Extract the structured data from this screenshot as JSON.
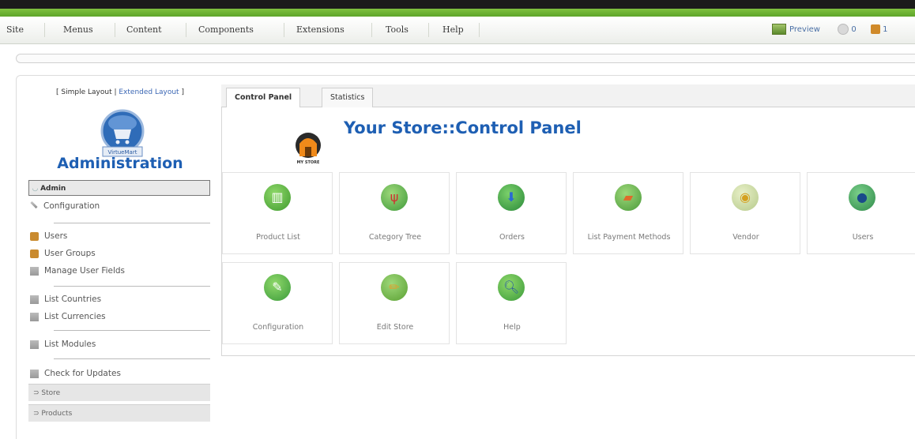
{
  "menubar": {
    "items": [
      "Site",
      "Menus",
      "Content",
      "Components",
      "Extensions",
      "Tools",
      "Help"
    ],
    "preview_label": "Preview",
    "messages_count": "0",
    "users_count": "1"
  },
  "sidebar": {
    "layout_open": "[ ",
    "simple_layout": "Simple Layout",
    "separator": " | ",
    "extended_layout": "Extended Layout",
    "layout_close": " ]",
    "logo_text": "VirtueMart",
    "title": "Administration",
    "section_header": "Admin",
    "items": [
      {
        "label": "Configuration",
        "icon": "wrench-icon"
      },
      {
        "label": "Users",
        "icon": "users-icon"
      },
      {
        "label": "User Groups",
        "icon": "user-groups-icon"
      },
      {
        "label": "Manage User Fields",
        "icon": "list-icon"
      },
      {
        "label": "List Countries",
        "icon": "list-icon"
      },
      {
        "label": "List Currencies",
        "icon": "list-icon"
      },
      {
        "label": "List Modules",
        "icon": "list-icon"
      },
      {
        "label": "Check for Updates",
        "icon": "list-icon"
      }
    ],
    "collapsed": [
      "Store",
      "Products"
    ]
  },
  "tabs": [
    {
      "label": "Control Panel",
      "active": true
    },
    {
      "label": "Statistics",
      "active": false
    }
  ],
  "main": {
    "store_icon_text": "MY STORE",
    "title": "Your Store::Control Panel",
    "tiles": [
      {
        "label": "Product List",
        "icon": "product-list-icon",
        "color": "#3f9a2e"
      },
      {
        "label": "Category Tree",
        "icon": "category-tree-icon",
        "color": "#c43030"
      },
      {
        "label": "Orders",
        "icon": "orders-icon",
        "color": "#2a8a3a"
      },
      {
        "label": "List Payment Methods",
        "icon": "payment-methods-icon",
        "color": "#e06a2a"
      },
      {
        "label": "Vendor",
        "icon": "vendor-icon",
        "color": "#b5c98a"
      },
      {
        "label": "Users",
        "icon": "users-icon",
        "color": "#2f8a4a"
      },
      {
        "label": "Configuration",
        "icon": "configuration-icon",
        "color": "#3a9a3a"
      },
      {
        "label": "Edit Store",
        "icon": "edit-store-icon",
        "color": "#5aa032"
      },
      {
        "label": "Help",
        "icon": "help-icon",
        "color": "#4a8ad4"
      }
    ]
  },
  "colors": {
    "accent_green": "#6ab234",
    "title_blue": "#1e5fb3",
    "link_blue": "#3b67b4"
  }
}
